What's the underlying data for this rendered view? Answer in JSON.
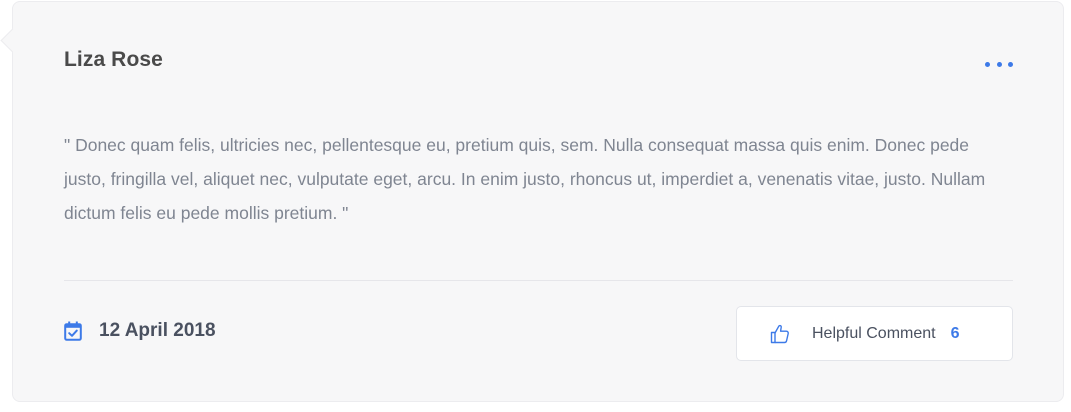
{
  "review": {
    "author": "Liza Rose",
    "comment": "\" Donec quam felis, ultricies nec, pellentesque eu, pretium quis, sem. Nulla consequat massa quis enim. Donec pede justo, fringilla vel, aliquet nec, vulputate eget, arcu. In enim justo, rhoncus ut, imperdiet a, venenatis vitae, justo. Nullam dictum felis eu pede mollis pretium. \"",
    "date": "12 April 2018",
    "helpful_label": "Helpful Comment",
    "helpful_count": "6"
  },
  "icons": {
    "more": "more-dots-icon",
    "calendar": "calendar-check-icon",
    "thumb": "thumbs-up-icon"
  },
  "colors": {
    "accent": "#3d7ae8",
    "card_background": "#f7f7f8",
    "heading_text": "#4a4a4a",
    "body_text": "#7f8591"
  }
}
